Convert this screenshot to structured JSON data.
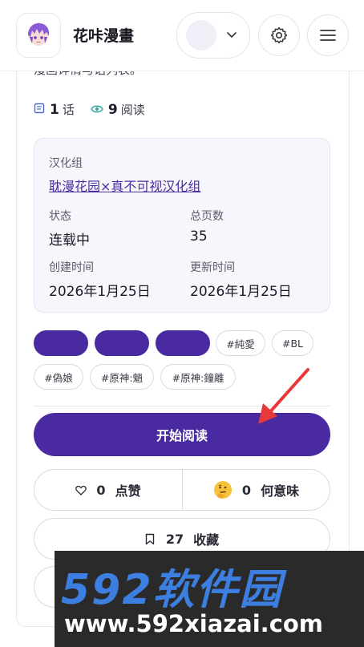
{
  "header": {
    "brand": "花咔漫畫",
    "settings_icon": "gear-icon",
    "menu_icon": "hamburger-menu-icon"
  },
  "comic": {
    "description": "漫画详情与话列表。",
    "chapters_count": "1",
    "chapters_unit": "话",
    "views_count": "9",
    "views_unit": "阅读"
  },
  "info": {
    "group_label": "汉化组",
    "group_name": "耽漫花园×真不可视汉化组",
    "status_label": "状态",
    "status_value": "连载中",
    "pages_label": "总页数",
    "pages_value": "35",
    "created_label": "创建时间",
    "created_value": "2026年1月25日",
    "updated_label": "更新时间",
    "updated_value": "2026年1月25日"
  },
  "tags": [
    "",
    "",
    "",
    "#純愛",
    "#BL",
    "#偽娘",
    "#原神:魈",
    "#原神:鐘離"
  ],
  "actions": {
    "start_reading": "开始阅读",
    "like_count": "0",
    "like_label": "点赞",
    "huh_count": "0",
    "huh_label": "何意味",
    "fav_count": "27",
    "fav_label": "收藏"
  },
  "watermark": {
    "big": "592软件园",
    "small": "www.592xiazai.com"
  },
  "colors": {
    "accent": "#4a2aa0",
    "annotation_arrow": "#e8393a"
  }
}
